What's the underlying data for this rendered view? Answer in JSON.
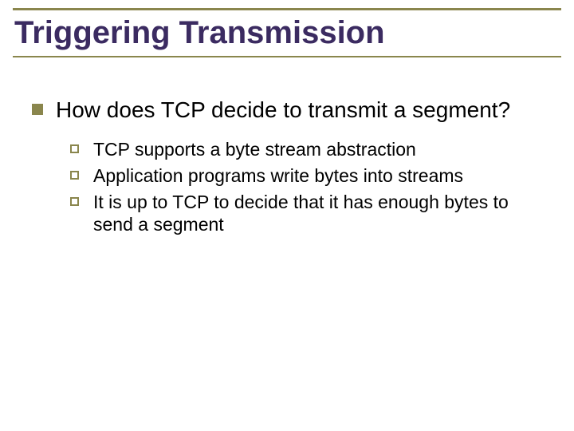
{
  "title": "Triggering Transmission",
  "main_bullet": "How does TCP decide to transmit a segment?",
  "sub_bullets": {
    "b0": "TCP supports a byte stream abstraction",
    "b1": "Application programs write bytes into streams",
    "b2": "It is up to TCP to decide that it has enough bytes to send a segment"
  }
}
